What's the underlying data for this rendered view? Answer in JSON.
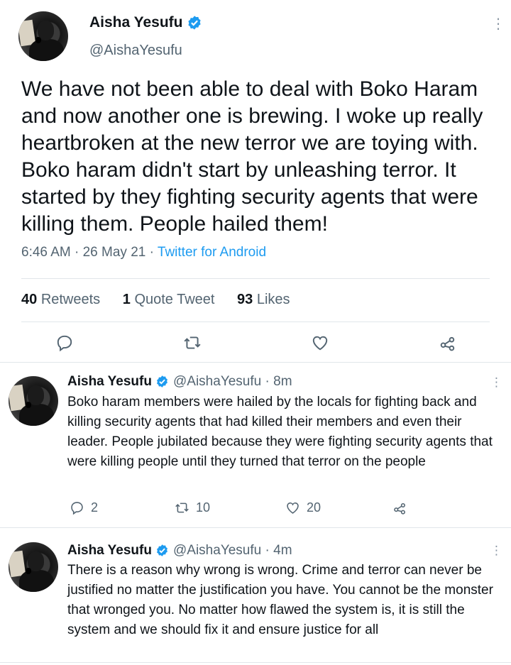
{
  "main_tweet": {
    "author_name": "Aisha Yesufu",
    "handle": "@AishaYesufu",
    "text": "We have not been able to deal with Boko Haram and now another one is brewing. I woke up really heartbroken at the new terror we are toying with. Boko haram didn't start by unleashing terror. It started by they fighting security agents that were killing them. People hailed them!",
    "time": "6:46 AM",
    "date": "26 May 21",
    "source": "Twitter for Android",
    "retweets_count": "40",
    "retweets_label": "Retweets",
    "quotes_count": "1",
    "quotes_label": "Quote Tweet",
    "likes_count": "93",
    "likes_label": "Likes",
    "actions": [
      "reply-icon",
      "retweet-icon",
      "like-icon",
      "share-icon"
    ]
  },
  "replies": [
    {
      "author_name": "Aisha Yesufu",
      "handle": "@AishaYesufu",
      "age": "8m",
      "text": "Boko haram members were hailed by the locals for fighting back and killing security agents that had killed their members and even their leader. People jubilated because they were fighting security  agents that were killing people until they turned that terror on the people",
      "reply_count": "2",
      "retweet_count": "10",
      "like_count": "20"
    },
    {
      "author_name": "Aisha Yesufu",
      "handle": "@AishaYesufu",
      "age": "4m",
      "text": "There is a reason why wrong is wrong. Crime and terror can never be justified no matter the justification you have. You cannot be the monster that wronged you. No matter how flawed the system is, it is still the system and we should fix it and ensure justice for all"
    }
  ],
  "meta_separator": " · ",
  "verified_color": "#1d9bf0",
  "secondary_text_color": "#536471"
}
